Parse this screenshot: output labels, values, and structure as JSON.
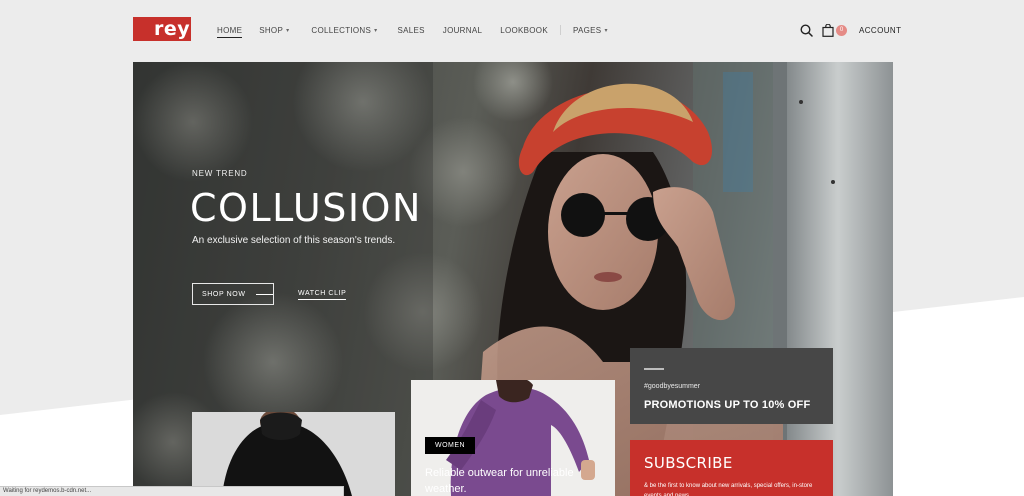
{
  "header": {
    "logo_text": "rey",
    "nav": [
      {
        "label": "HOME",
        "has_caret": false,
        "active": true
      },
      {
        "label": "SHOP",
        "has_caret": true,
        "active": false
      },
      {
        "label": "COLLECTIONS",
        "has_caret": true,
        "active": false
      },
      {
        "label": "SALES",
        "has_caret": false,
        "active": false
      },
      {
        "label": "JOURNAL",
        "has_caret": false,
        "active": false
      },
      {
        "label": "LOOKBOOK",
        "has_caret": false,
        "active": false
      },
      {
        "label": "PAGES",
        "has_caret": true,
        "active": false
      }
    ],
    "cart_count": "0",
    "account_label": "ACCOUNT",
    "icons": [
      "search-icon",
      "shopping-bag-icon"
    ]
  },
  "hero": {
    "eyebrow": "NEW TREND",
    "title": "COLLUSION",
    "subtitle": "An exclusive selection of this season's trends.",
    "primary_button": "SHOP NOW",
    "secondary_link": "WATCH CLIP"
  },
  "cards": {
    "women_badge": "WOMEN",
    "women_text": "Reliable outwear for unreliable weather."
  },
  "promo": {
    "tag": "#goodbyesummer",
    "title": "PROMOTIONS UP TO 10% OFF"
  },
  "subscribe": {
    "title": "SUBSCRIBE",
    "description": "& be the first to know about new arrivals, special offers, in-store events and news"
  },
  "status_bar": "Waiting for reydemos.b-cdn.net...",
  "colors": {
    "brand_red": "#c7302b",
    "promo_gray": "#474747",
    "cart_badge": "#e58b86"
  }
}
